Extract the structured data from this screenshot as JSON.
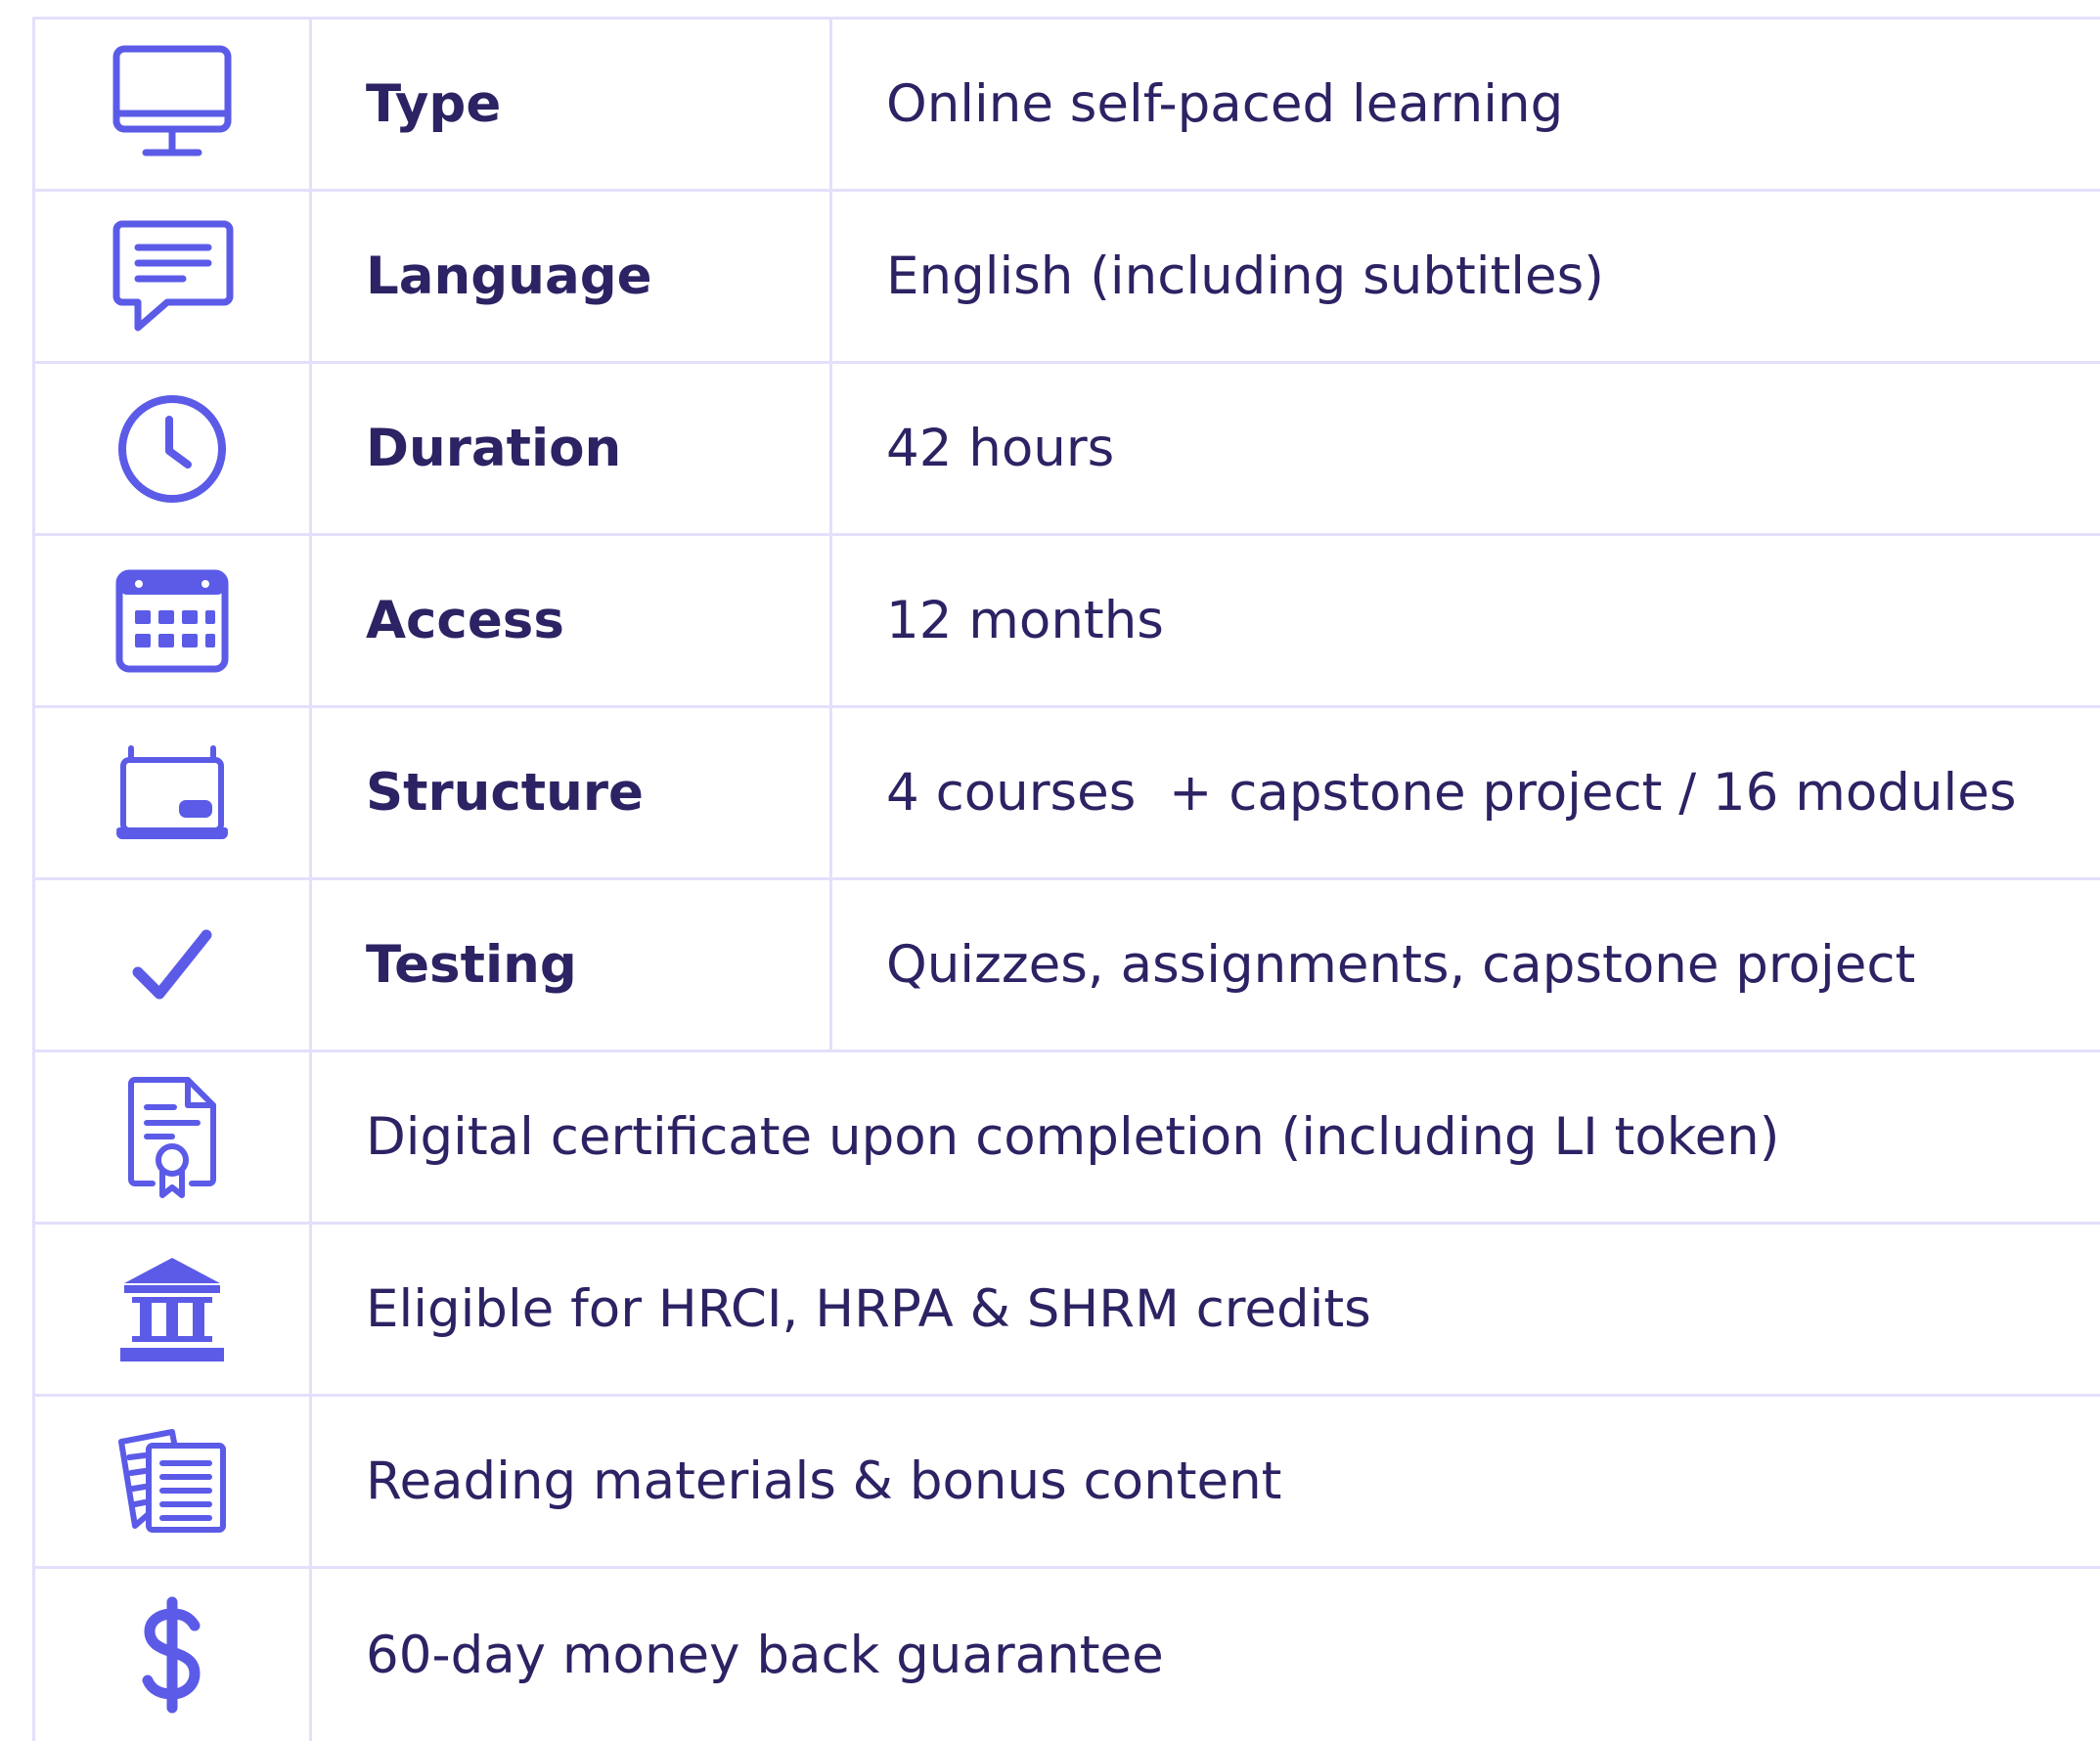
{
  "colors": {
    "icon": "#5b5be8",
    "text": "#2b2363",
    "border": "#e2e0fb"
  },
  "rows": [
    {
      "icon": "monitor-icon",
      "label": "Type",
      "value": "Online self-paced learning"
    },
    {
      "icon": "chat-bubble-icon",
      "label": "Language",
      "value": "English (including subtitles)"
    },
    {
      "icon": "clock-icon",
      "label": "Duration",
      "value": "42 hours"
    },
    {
      "icon": "calendar-icon",
      "label": "Access",
      "value": "12 months"
    },
    {
      "icon": "whiteboard-icon",
      "label": "Structure",
      "value": "4 courses  + capstone project / 16 modules"
    },
    {
      "icon": "checkmark-icon",
      "label": "Testing",
      "value": "Quizzes, assignments, capstone project"
    }
  ],
  "features": [
    {
      "icon": "certificate-icon",
      "text": "Digital certificate upon completion (including LI token)"
    },
    {
      "icon": "institution-icon",
      "text": "Eligible for HRCI, HRPA & SHRM credits"
    },
    {
      "icon": "reading-materials-icon",
      "text": "Reading materials & bonus content"
    },
    {
      "icon": "dollar-icon",
      "text": "60-day money back guarantee"
    }
  ]
}
